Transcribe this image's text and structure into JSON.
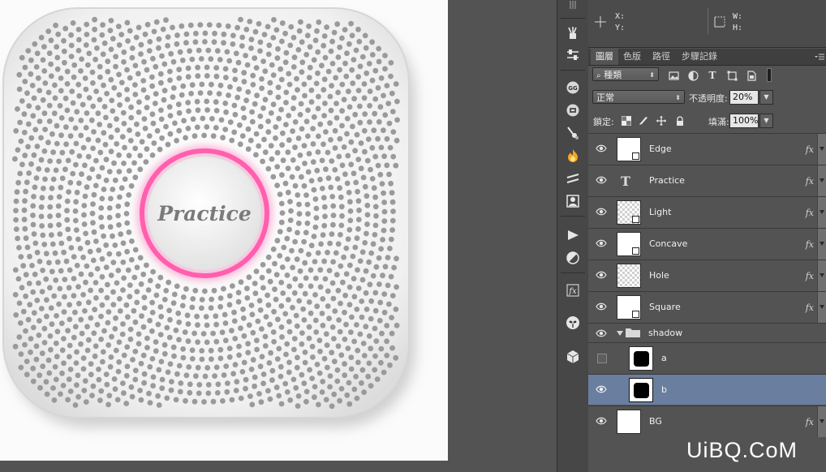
{
  "canvas": {
    "artwork_label": "Practice",
    "colors": {
      "ring": "#ff5fae",
      "body": "#f2f2f2",
      "hole": "#9a9a9a",
      "background": "#fbfbfb"
    }
  },
  "toolstrip": {
    "icons": [
      "paint-tool-icon",
      "sliders-icon",
      "gg-icon",
      "swatches-icon",
      "brush-settings-icon",
      "fire-icon",
      "stroke-icon",
      "portrait-icon",
      "play-icon",
      "gradient-icon",
      "fx-icon",
      "alien-icon",
      "cube-icon"
    ]
  },
  "info": {
    "x_label": "X:",
    "y_label": "Y:",
    "w_label": "W:",
    "h_label": "H:"
  },
  "tabs": [
    "圖層",
    "色版",
    "路徑",
    "步驟記錄"
  ],
  "filter": {
    "label": "種類"
  },
  "blend": {
    "mode": "正常",
    "opacity_label": "不透明度:",
    "opacity_value": "20%"
  },
  "lock": {
    "label": "鎖定:",
    "fill_label": "填滿:",
    "fill_value": "100%"
  },
  "layers": [
    {
      "name": "Edge",
      "kind": "image",
      "visible": true,
      "fx": "fx"
    },
    {
      "name": "Practice",
      "kind": "text",
      "visible": true,
      "fx": "fx"
    },
    {
      "name": "Light",
      "kind": "checker",
      "visible": true,
      "fx": "fx"
    },
    {
      "name": "Concave",
      "kind": "image",
      "visible": true,
      "fx": "fx"
    },
    {
      "name": "Hole",
      "kind": "checker",
      "visible": true,
      "fx": "fx"
    },
    {
      "name": "Square",
      "kind": "image",
      "visible": true,
      "fx": "fx"
    },
    {
      "name": "shadow",
      "kind": "group",
      "visible": true
    },
    {
      "name": "a",
      "kind": "mask",
      "visible": false
    },
    {
      "name": "b",
      "kind": "mask",
      "visible": true,
      "selected": true
    },
    {
      "name": "BG",
      "kind": "plain",
      "visible": true,
      "fx": "fx"
    }
  ],
  "watermark": "UiBQ.CoM"
}
